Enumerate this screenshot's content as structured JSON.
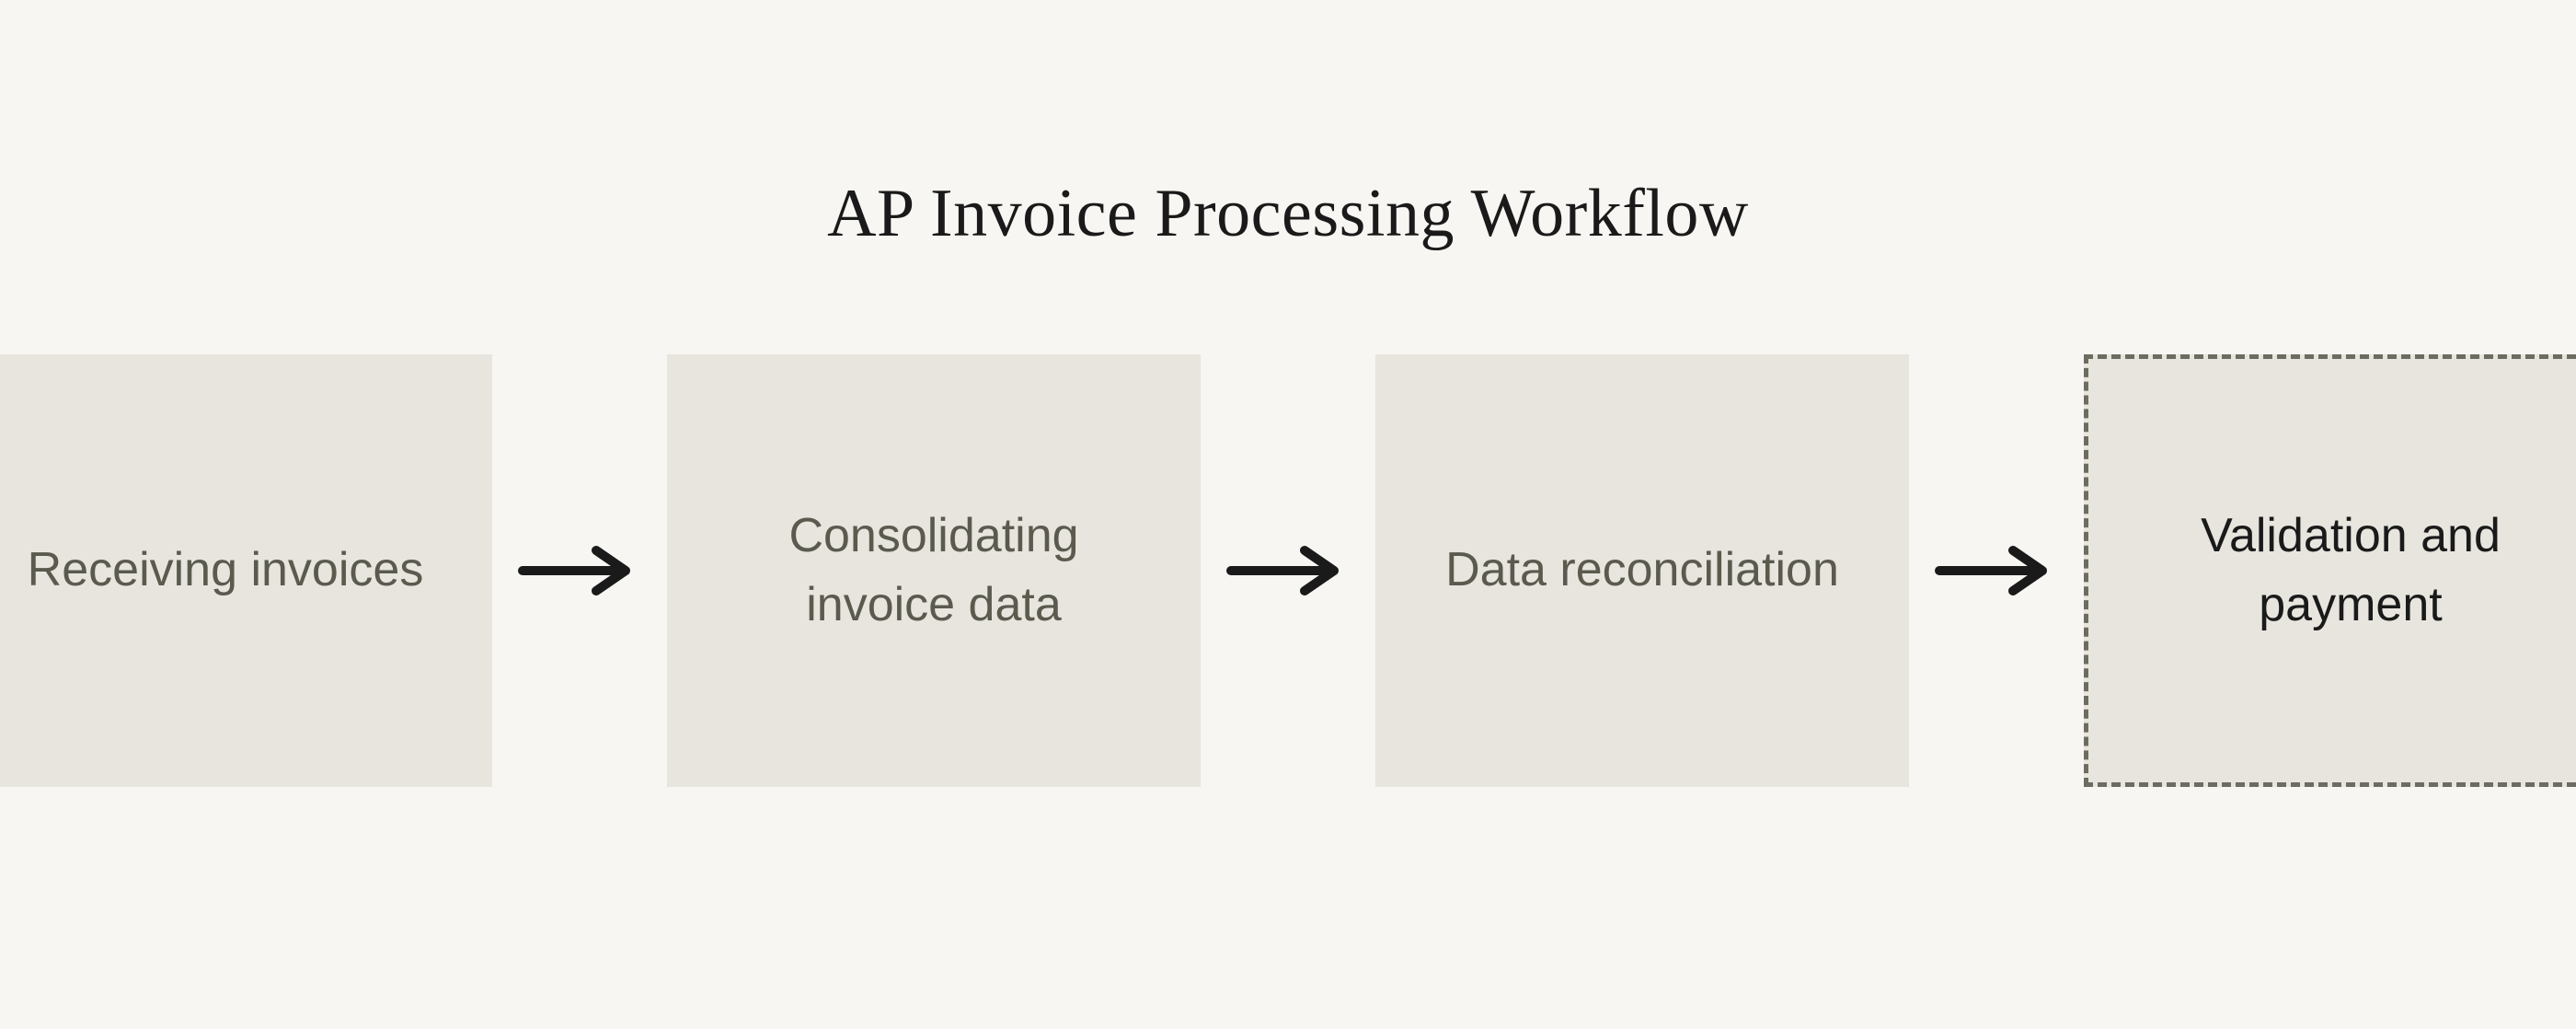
{
  "title": "AP Invoice Processing Workflow",
  "steps": [
    {
      "label": "Receiving invoices",
      "dashed": false
    },
    {
      "label": "Consolidating invoice data",
      "dashed": false
    },
    {
      "label": "Data reconciliation",
      "dashed": false
    },
    {
      "label": "Validation and payment",
      "dashed": true
    }
  ]
}
